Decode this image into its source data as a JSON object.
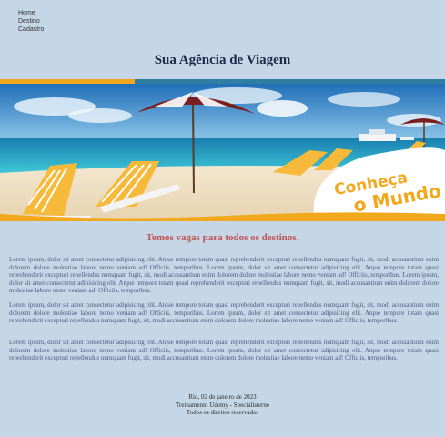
{
  "nav": {
    "items": [
      "Home",
      "Destino",
      "Cadastro"
    ]
  },
  "header": {
    "title": "Sua Agência de Viagem"
  },
  "banner": {
    "tagline_line1": "Conheça",
    "tagline_line2": "o Mundo"
  },
  "main": {
    "subtitle": "Temos vagas para todos os destinos.",
    "paragraphs": [
      "Lorem ipsum, dolor sit amet consectetur adipisicing elit. Atque tempore totam quasi reprehenderit excepturi repellendus numquam fugit, sit, modi accusantium enim dolorem dolore molestiae labore nemo veniam ad! Officiis, temporibus. Lorem ipsum, dolor sit amet consectetur adipisicing elit. Atque tempore totam quasi reprehenderit excepturi repellendus numquam fugit, sit, modi accusantium enim dolorem dolore molestiae labore nemo veniam ad! Officiis, temporibus. Lorem ipsum, dolor sit amet consectetur adipisicing elit. Atque tempore totam quasi reprehenderit excepturi repellendus numquam fugit, sit, modi accusantium enim dolorem dolore molestiae labore nemo veniam ad! Officiis, temporibus.",
      "Lorem ipsum, dolor sit amet consectetur adipisicing elit. Atque tempore totam quasi reprehenderit excepturi repellendus numquam fugit, sit, modi accusantium enim dolorem dolore molestiae labore nemo veniam ad! Officiis, temporibus. Lorem ipsum, dolor sit amet consectetur adipisicing elit. Atque tempore totam quasi reprehenderit excepturi repellendus numquam fugit, sit, modi accusantium enim dolorem dolore molestiae labore nemo veniam ad! Officiis, temporibus.",
      "Lorem ipsum, dolor sit amet consectetur adipisicing elit. Atque tempore totam quasi reprehenderit excepturi repellendus numquam fugit, sit, modi accusantium enim dolorem dolore molestiae labore nemo veniam ad! Officiis, temporibus. Lorem ipsum, dolor sit amet consectetur adipisicing elit. Atque tempore totam quasi reprehenderit excepturi repellendus numquam fugit, sit, modi accusantium enim dolorem dolore molestiae labore nemo veniam ad! Officiis, temporibus."
    ]
  },
  "footer": {
    "line1": "Rio, 02 de janeiro de 2023",
    "line2": "Treinamento Udemy - Specialisterne",
    "line3": "Todos os direitos reservados"
  }
}
